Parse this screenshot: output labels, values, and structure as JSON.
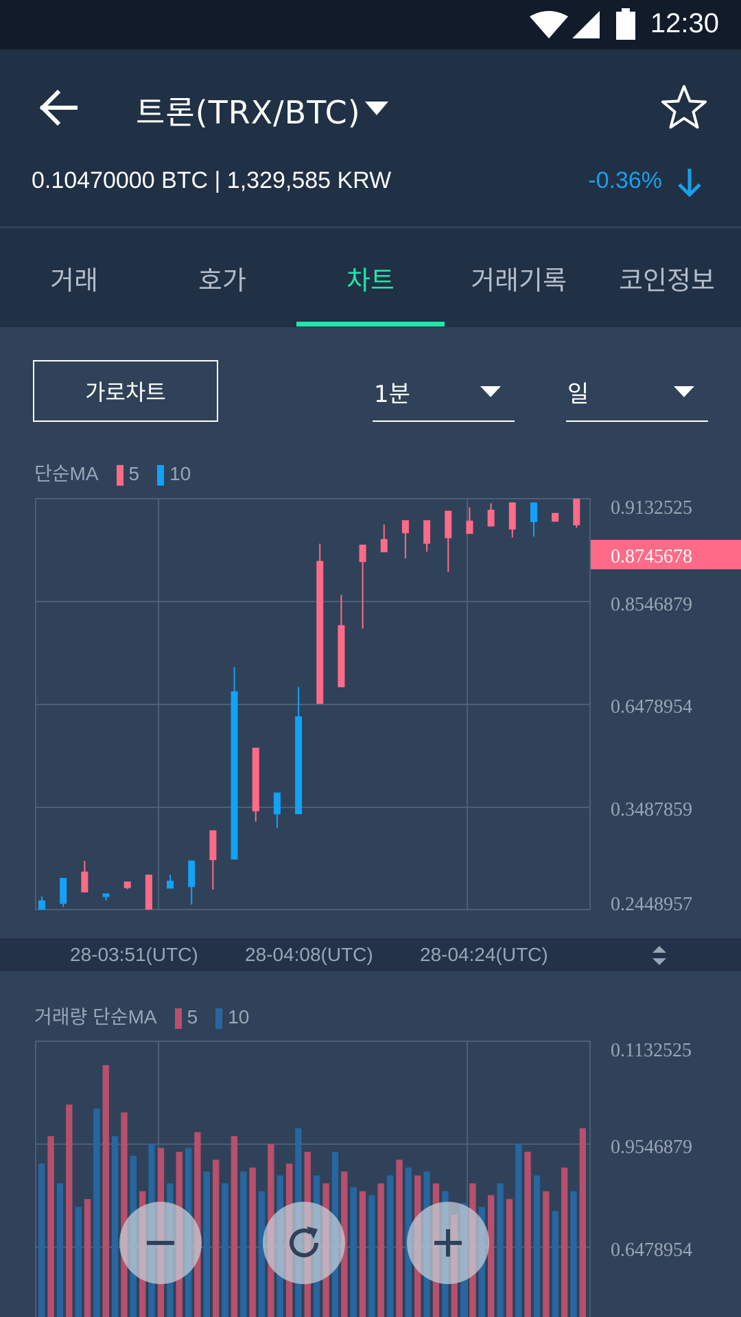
{
  "status_bar": {
    "time": "12:30"
  },
  "header": {
    "title": "트론(TRX/BTC)",
    "price": "0.10470000 BTC | 1,329,585 KRW",
    "change": "-0.36%"
  },
  "tabs": [
    {
      "label": "거래"
    },
    {
      "label": "호가"
    },
    {
      "label": "차트"
    },
    {
      "label": "거래기록"
    },
    {
      "label": "코인정보"
    }
  ],
  "controls": {
    "landscape_label": "가로차트",
    "interval": "1분",
    "period": "일"
  },
  "price_chart": {
    "legend": {
      "label": "단순MA",
      "ma_short": "5",
      "ma_long": "10"
    },
    "current_price_label": "0.8745678",
    "y_labels": [
      "0.9132525",
      "0.8546879",
      "0.6478954",
      "0.3487859",
      "0.2448957"
    ],
    "x_labels": [
      "28-03:51(UTC)",
      "28-04:08(UTC)",
      "28-04:24(UTC)"
    ]
  },
  "volume_chart": {
    "legend": {
      "label": "거래량 단순MA",
      "ma_short": "5",
      "ma_long": "10"
    },
    "y_labels": [
      "0.1132525",
      "0.9546879",
      "0.6478954"
    ]
  },
  "colors": {
    "up": "#ff6b87",
    "down": "#12a2f7",
    "accent": "#1ee7a8",
    "vol_up": "#b6506c",
    "vol_down": "#2766a0"
  },
  "chart_data": [
    {
      "type": "candlestick",
      "title": "",
      "ylim": [
        0.2448957,
        0.9132525
      ],
      "candles": [
        {
          "open": 0.2598,
          "close": 0.2448,
          "high": 0.2662,
          "low": 0.2448
        },
        {
          "open": 0.2963,
          "close": 0.2542,
          "high": 0.2963,
          "low": 0.2493
        },
        {
          "open": 0.2729,
          "close": 0.3067,
          "high": 0.3239,
          "low": 0.2729
        },
        {
          "open": 0.2711,
          "close": 0.2653,
          "high": 0.2711,
          "low": 0.2597
        },
        {
          "open": 0.2799,
          "close": 0.2905,
          "high": 0.2905,
          "low": 0.2779
        },
        {
          "open": 0.2448,
          "close": 0.3016,
          "high": 0.3016,
          "low": 0.2448
        },
        {
          "open": 0.2918,
          "close": 0.279,
          "high": 0.3012,
          "low": 0.279
        },
        {
          "open": 0.3246,
          "close": 0.2815,
          "high": 0.3246,
          "low": 0.2531
        },
        {
          "open": 0.3254,
          "close": 0.3737,
          "high": 0.3737,
          "low": 0.2773
        },
        {
          "open": 0.6,
          "close": 0.3263,
          "high": 0.6392,
          "low": 0.3263
        },
        {
          "open": 0.4047,
          "close": 0.5082,
          "high": 0.5082,
          "low": 0.388
        },
        {
          "open": 0.4352,
          "close": 0.3996,
          "high": 0.4352,
          "low": 0.3773
        },
        {
          "open": 0.5592,
          "close": 0.4,
          "high": 0.6069,
          "low": 0.4
        },
        {
          "open": 0.5796,
          "close": 0.812,
          "high": 0.84,
          "low": 0.5796
        },
        {
          "open": 0.6065,
          "close": 0.7074,
          "high": 0.7569,
          "low": 0.6065
        },
        {
          "open": 0.8102,
          "close": 0.8385,
          "high": 0.8385,
          "low": 0.702
        },
        {
          "open": 0.8261,
          "close": 0.8475,
          "high": 0.8713,
          "low": 0.8261
        },
        {
          "open": 0.857,
          "close": 0.8782,
          "high": 0.8782,
          "low": 0.8161
        },
        {
          "open": 0.84,
          "close": 0.8782,
          "high": 0.8782,
          "low": 0.827
        },
        {
          "open": 0.849,
          "close": 0.8936,
          "high": 0.8936,
          "low": 0.794
        },
        {
          "open": 0.856,
          "close": 0.8775,
          "high": 0.8992,
          "low": 0.856
        },
        {
          "open": 0.868,
          "close": 0.8952,
          "high": 0.9059,
          "low": 0.868
        },
        {
          "open": 0.8631,
          "close": 0.9072,
          "high": 0.9072,
          "low": 0.85
        },
        {
          "open": 0.9072,
          "close": 0.8751,
          "high": 0.9072,
          "low": 0.8516
        },
        {
          "open": 0.8759,
          "close": 0.89,
          "high": 0.89,
          "low": 0.8759
        },
        {
          "open": 0.87,
          "close": 0.9132,
          "high": 0.9132,
          "low": 0.866
        }
      ]
    },
    {
      "type": "bar",
      "title": "",
      "ylim": [
        0.5,
        1.2
      ],
      "values": [
        {
          "v": 0.75,
          "up": false
        },
        {
          "v": 0.82,
          "up": true
        },
        {
          "v": 0.7,
          "up": false
        },
        {
          "v": 0.9,
          "up": true
        },
        {
          "v": 0.64,
          "up": false
        },
        {
          "v": 0.66,
          "up": true
        },
        {
          "v": 0.89,
          "up": false
        },
        {
          "v": 1.0,
          "up": true
        },
        {
          "v": 0.82,
          "up": false
        },
        {
          "v": 0.88,
          "up": true
        },
        {
          "v": 0.77,
          "up": false
        },
        {
          "v": 0.68,
          "up": true
        },
        {
          "v": 0.8,
          "up": false
        },
        {
          "v": 0.79,
          "up": true
        },
        {
          "v": 0.7,
          "up": false
        },
        {
          "v": 0.78,
          "up": true
        },
        {
          "v": 0.79,
          "up": false
        },
        {
          "v": 0.83,
          "up": true
        },
        {
          "v": 0.73,
          "up": false
        },
        {
          "v": 0.76,
          "up": true
        },
        {
          "v": 0.7,
          "up": false
        },
        {
          "v": 0.82,
          "up": true
        },
        {
          "v": 0.73,
          "up": false
        },
        {
          "v": 0.74,
          "up": true
        },
        {
          "v": 0.68,
          "up": false
        },
        {
          "v": 0.8,
          "up": true
        },
        {
          "v": 0.72,
          "up": false
        },
        {
          "v": 0.75,
          "up": true
        },
        {
          "v": 0.84,
          "up": false
        },
        {
          "v": 0.78,
          "up": true
        },
        {
          "v": 0.72,
          "up": false
        },
        {
          "v": 0.7,
          "up": true
        },
        {
          "v": 0.78,
          "up": false
        },
        {
          "v": 0.73,
          "up": true
        },
        {
          "v": 0.69,
          "up": false
        },
        {
          "v": 0.68,
          "up": true
        },
        {
          "v": 0.67,
          "up": false
        },
        {
          "v": 0.7,
          "up": true
        },
        {
          "v": 0.72,
          "up": false
        },
        {
          "v": 0.76,
          "up": true
        },
        {
          "v": 0.74,
          "up": false
        },
        {
          "v": 0.72,
          "up": true
        },
        {
          "v": 0.73,
          "up": false
        },
        {
          "v": 0.7,
          "up": true
        },
        {
          "v": 0.68,
          "up": false
        },
        {
          "v": 0.62,
          "up": true
        },
        {
          "v": 0.65,
          "up": false
        },
        {
          "v": 0.7,
          "up": true
        },
        {
          "v": 0.64,
          "up": false
        },
        {
          "v": 0.67,
          "up": true
        },
        {
          "v": 0.7,
          "up": false
        },
        {
          "v": 0.66,
          "up": true
        },
        {
          "v": 0.8,
          "up": false
        },
        {
          "v": 0.78,
          "up": true
        },
        {
          "v": 0.72,
          "up": false
        },
        {
          "v": 0.68,
          "up": true
        },
        {
          "v": 0.63,
          "up": false
        },
        {
          "v": 0.74,
          "up": true
        },
        {
          "v": 0.68,
          "up": false
        },
        {
          "v": 0.84,
          "up": true
        }
      ]
    }
  ]
}
